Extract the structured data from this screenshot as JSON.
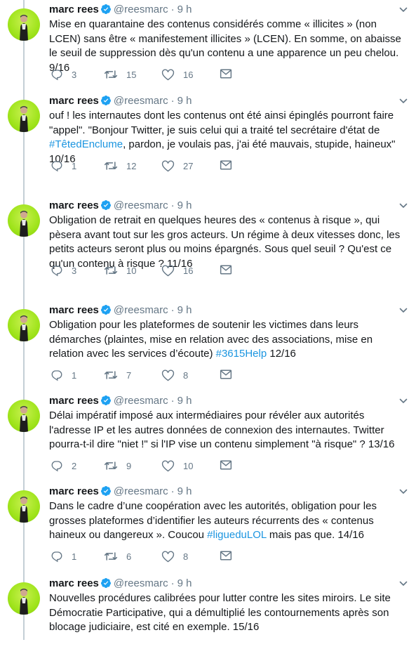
{
  "user": {
    "name": "marc rees",
    "handle": "@reesmarc",
    "separator": "·",
    "time": "9 h"
  },
  "colors": {
    "link": "#1b95e0",
    "muted": "#657786",
    "verified": "#1da1f2",
    "avatar_bg": "#9fe41b"
  },
  "icons": {
    "reply": "reply-icon",
    "retweet": "retweet-icon",
    "like": "heart-icon",
    "dm": "mail-icon",
    "verified": "verified-badge-icon",
    "more": "chevron-down-icon"
  },
  "tweets": [
    {
      "text_parts": [
        {
          "t": "Mise en quarantaine des contenus considérés comme « illicites » (non LCEN) sans être « manifestement illicites » (LCEN). En somme, on abaisse le seuil de suppression dès qu'un contenu a une apparence un peu chelou. 9/16"
        }
      ],
      "replies": "3",
      "retweets": "15",
      "likes": "16"
    },
    {
      "text_parts": [
        {
          "t": "ouf ! les internautes dont les contenus ont été ainsi épinglés pourront faire \"appel\". \"Bonjour Twitter, je suis celui qui a traité tel secrétaire d'état de "
        },
        {
          "t": "#TêtedEnclume",
          "link": true
        },
        {
          "t": ", pardon, je voulais pas, j'ai été mauvais, stupide, haineux\" 10/16"
        }
      ],
      "replies": "1",
      "retweets": "12",
      "likes": "27"
    },
    {
      "text_parts": [
        {
          "t": "Obligation de retrait en quelques heures des « contenus à risque », qui pèsera avant tout sur les gros acteurs. Un régime à deux vitesses donc, les petits acteurs seront plus ou moins épargnés. Sous quel seuil ? Qu'est ce qu'un contenu à risque ? 11/16"
        }
      ],
      "replies": "3",
      "retweets": "10",
      "likes": "16"
    },
    {
      "text_parts": [
        {
          "t": "Obligation pour les plateformes de soutenir les victimes dans leurs démarches (plaintes, mise en relation avec des associations, mise en relation avec les services d’écoute) "
        },
        {
          "t": "#3615Help",
          "link": true
        },
        {
          "t": " 12/16"
        }
      ],
      "replies": "1",
      "retweets": "7",
      "likes": "8"
    },
    {
      "text_parts": [
        {
          "t": "Délai impératif imposé aux intermédiaires pour révéler aux autorités l'adresse IP et les autres données de connexion des internautes. Twitter pourra-t-il dire \"niet !\" si l'IP vise un contenu simplement \"à risque\" ? 13/16"
        }
      ],
      "replies": "2",
      "retweets": "9",
      "likes": "10"
    },
    {
      "text_parts": [
        {
          "t": "Dans le cadre d’une coopération avec les autorités, obligation pour les grosses plateformes d’identifier les auteurs récurrents des « contenus haineux ou dangereux ». Coucou "
        },
        {
          "t": "#ligueduLOL",
          "link": true
        },
        {
          "t": " mais pas que. 14/16"
        }
      ],
      "replies": "1",
      "retweets": "6",
      "likes": "8"
    },
    {
      "text_parts": [
        {
          "t": "Nouvelles procédures calibrées pour lutter contre les sites miroirs. Le site Démocratie Participative, qui a démultiplié les contournements après son blocage judiciaire, est cité en exemple. 15/16"
        }
      ],
      "replies": "",
      "retweets": "",
      "likes": ""
    }
  ]
}
